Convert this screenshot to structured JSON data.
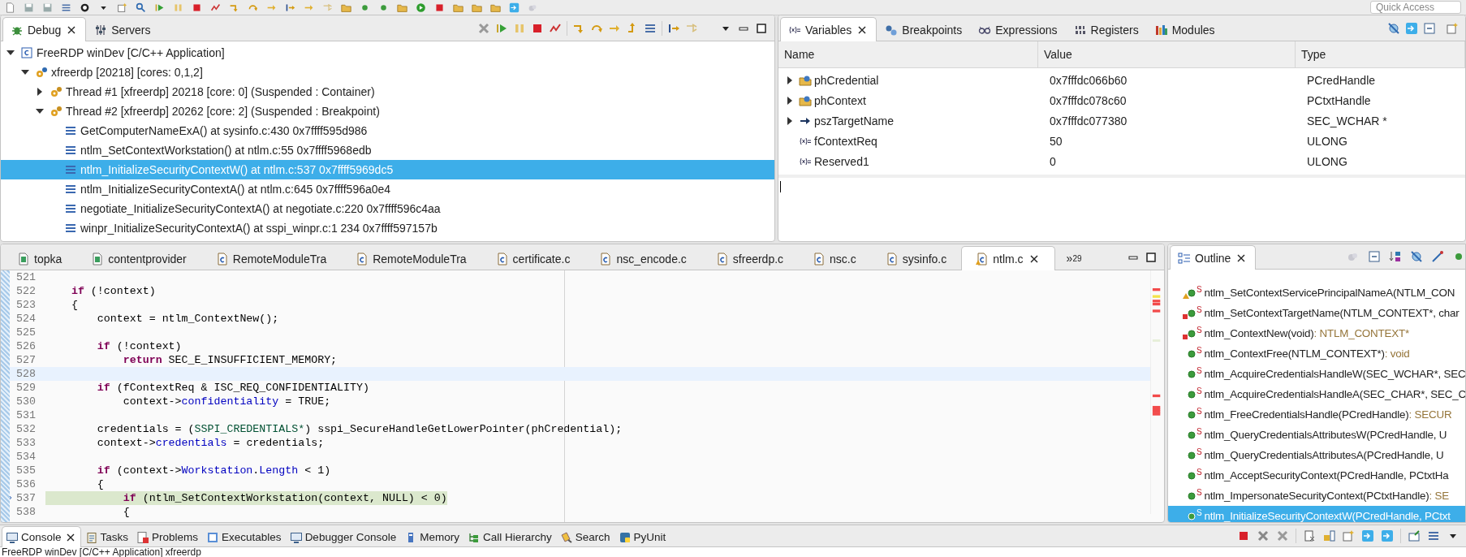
{
  "toolbar": {
    "quick_access": {
      "placeholder": "Quick Access"
    }
  },
  "debug_view": {
    "tabs": [
      {
        "label": "Debug",
        "selected": true,
        "closable": true
      },
      {
        "label": "Servers",
        "selected": false,
        "closable": false
      }
    ],
    "tree": [
      {
        "label": "FreeRDP winDev [C/C++ Application]",
        "kind": "launch",
        "expanded": true,
        "selected": false,
        "children": [
          {
            "label": "xfreerdp [20218] [cores: 0,1,2]",
            "kind": "process",
            "expanded": true,
            "selected": false,
            "children": [
              {
                "label": "Thread #1 [xfreerdp] 20218 [core: 0] (Suspended : Container)",
                "kind": "thread",
                "expanded": false,
                "selected": false
              },
              {
                "label": "Thread #2 [xfreerdp] 20262 [core: 2] (Suspended : Breakpoint)",
                "kind": "thread",
                "expanded": true,
                "selected": false,
                "children": [
                  {
                    "label": "GetComputerNameExA() at sysinfo.c:430 0x7ffff595d986",
                    "kind": "frame",
                    "selected": false
                  },
                  {
                    "label": "ntlm_SetContextWorkstation() at ntlm.c:55 0x7ffff5968edb",
                    "kind": "frame",
                    "selected": false
                  },
                  {
                    "label": "ntlm_InitializeSecurityContextW() at ntlm.c:537 0x7ffff5969dc5",
                    "kind": "frame",
                    "selected": true
                  },
                  {
                    "label": "ntlm_InitializeSecurityContextA() at ntlm.c:645 0x7ffff596a0e4",
                    "kind": "frame",
                    "selected": false
                  },
                  {
                    "label": "negotiate_InitializeSecurityContextA() at negotiate.c:220 0x7ffff596c4aa",
                    "kind": "frame",
                    "selected": false
                  },
                  {
                    "label": "winpr_InitializeSecurityContextA() at sspi_winpr.c:1 234 0x7ffff597157b",
                    "kind": "frame",
                    "selected": false
                  }
                ]
              }
            ]
          }
        ]
      }
    ]
  },
  "variables_view": {
    "tabs": [
      {
        "label": "Variables",
        "selected": true,
        "closable": true
      },
      {
        "label": "Breakpoints",
        "selected": false,
        "closable": false
      },
      {
        "label": "Expressions",
        "selected": false,
        "closable": false
      },
      {
        "label": "Registers",
        "selected": false,
        "closable": false
      },
      {
        "label": "Modules",
        "selected": false,
        "closable": false
      }
    ],
    "columns": [
      "Name",
      "Value",
      "Type"
    ],
    "rows": [
      {
        "name": "phCredential",
        "value": "0x7fffdc066b60",
        "type": "PCredHandle",
        "kind": "struct",
        "expandable": true
      },
      {
        "name": "phContext",
        "value": "0x7fffdc078c60",
        "type": "PCtxtHandle",
        "kind": "struct",
        "expandable": true
      },
      {
        "name": "pszTargetName",
        "value": "0x7fffdc077380",
        "type": "SEC_WCHAR *",
        "kind": "pointer",
        "expandable": true
      },
      {
        "name": "fContextReq",
        "value": "50",
        "type": "ULONG",
        "kind": "local",
        "expandable": false
      },
      {
        "name": "Reserved1",
        "value": "0",
        "type": "ULONG",
        "kind": "local",
        "expandable": false
      }
    ]
  },
  "editor": {
    "tabs": [
      {
        "label": "topka",
        "kind": "project",
        "selected": false,
        "warning": false,
        "closable": false
      },
      {
        "label": "contentprovider",
        "kind": "project",
        "selected": false,
        "warning": false,
        "closable": false
      },
      {
        "label": "RemoteModuleTra",
        "kind": "c",
        "selected": false,
        "warning": false,
        "closable": false
      },
      {
        "label": "RemoteModuleTra",
        "kind": "c",
        "selected": false,
        "warning": false,
        "closable": false
      },
      {
        "label": "certificate.c",
        "kind": "c",
        "selected": false,
        "warning": false,
        "closable": false
      },
      {
        "label": "nsc_encode.c",
        "kind": "c",
        "selected": false,
        "warning": false,
        "closable": false
      },
      {
        "label": "sfreerdp.c",
        "kind": "c",
        "selected": false,
        "warning": false,
        "closable": false
      },
      {
        "label": "nsc.c",
        "kind": "c",
        "selected": false,
        "warning": false,
        "closable": false
      },
      {
        "label": "sysinfo.c",
        "kind": "c",
        "selected": false,
        "warning": false,
        "closable": false
      },
      {
        "label": "ntlm.c",
        "kind": "c",
        "selected": true,
        "warning": true,
        "closable": true
      }
    ],
    "overflow": {
      "label": "»",
      "count": "29"
    },
    "lines": [
      {
        "number": "521"
      },
      {
        "number": "522",
        "tokens": [
          {
            "kind": "kw",
            "text": "    if"
          },
          {
            "kind": "plain",
            "text": " (!context)"
          }
        ]
      },
      {
        "number": "523",
        "tokens": [
          {
            "kind": "plain",
            "text": "    {"
          }
        ]
      },
      {
        "number": "524",
        "tokens": [
          {
            "kind": "plain",
            "text": "        context = ntlm_ContextNew();"
          }
        ]
      },
      {
        "number": "525"
      },
      {
        "number": "526",
        "tokens": [
          {
            "kind": "kw",
            "text": "        if"
          },
          {
            "kind": "plain",
            "text": " (!context)"
          }
        ]
      },
      {
        "number": "527",
        "tokens": [
          {
            "kind": "kw",
            "text": "            return"
          },
          {
            "kind": "plain",
            "text": " SEC_E_INSUFFICIENT_MEMORY;"
          }
        ]
      },
      {
        "number": "528",
        "cursor": true
      },
      {
        "number": "529",
        "tokens": [
          {
            "kind": "kw",
            "text": "        if"
          },
          {
            "kind": "plain",
            "text": " (fContextReq & ISC_REQ_CONFIDENTIALITY)"
          }
        ]
      },
      {
        "number": "530",
        "tokens": [
          {
            "kind": "plain",
            "text": "            context->"
          },
          {
            "kind": "field",
            "text": "confidentiality"
          },
          {
            "kind": "plain",
            "text": " = TRUE;"
          }
        ]
      },
      {
        "number": "531"
      },
      {
        "number": "532",
        "tokens": [
          {
            "kind": "plain",
            "text": "        credentials = ("
          },
          {
            "kind": "type",
            "text": "SSPI_CREDENTIALS*"
          },
          {
            "kind": "plain",
            "text": ") sspi_SecureHandleGetLowerPointer(phCredential);"
          }
        ]
      },
      {
        "number": "533",
        "tokens": [
          {
            "kind": "plain",
            "text": "        context->"
          },
          {
            "kind": "field",
            "text": "credentials"
          },
          {
            "kind": "plain",
            "text": " = credentials;"
          }
        ]
      },
      {
        "number": "534"
      },
      {
        "number": "535",
        "tokens": [
          {
            "kind": "kw",
            "text": "        if"
          },
          {
            "kind": "plain",
            "text": " (context->"
          },
          {
            "kind": "field",
            "text": "Workstation"
          },
          {
            "kind": "plain",
            "text": "."
          },
          {
            "kind": "field",
            "text": "Length"
          },
          {
            "kind": "plain",
            "text": " < 1)"
          }
        ]
      },
      {
        "number": "536",
        "tokens": [
          {
            "kind": "plain",
            "text": "        {"
          }
        ]
      },
      {
        "number": "537",
        "current": true,
        "tokens": [
          {
            "kind": "kw",
            "text": "            if"
          },
          {
            "kind": "plain",
            "text": " (ntlm_SetContextWorkstation(context, NULL) < 0)"
          }
        ]
      },
      {
        "number": "538",
        "tokens": [
          {
            "kind": "plain",
            "text": "            {"
          }
        ]
      }
    ]
  },
  "outline": {
    "tab": {
      "label": "Outline",
      "selected": true,
      "closable": true
    },
    "items": [
      {
        "signature": "ntlm_SetContextServicePrincipalNameA(NTLM_CON",
        "modifier": "S",
        "kind": "warning",
        "selected": false
      },
      {
        "signature": "ntlm_SetContextTargetName(NTLM_CONTEXT*, char",
        "modifier": "S",
        "kind": "error",
        "selected": false
      },
      {
        "signature": "ntlm_ContextNew(void)",
        "return_type": " : NTLM_CONTEXT*",
        "modifier": "S",
        "kind": "error",
        "selected": false
      },
      {
        "signature": "ntlm_ContextFree(NTLM_CONTEXT*)",
        "return_type": " : void",
        "modifier": "S",
        "kind": "method",
        "selected": false
      },
      {
        "signature": "ntlm_AcquireCredentialsHandleW(SEC_WCHAR*, SEC",
        "modifier": "S",
        "kind": "method",
        "selected": false
      },
      {
        "signature": "ntlm_AcquireCredentialsHandleA(SEC_CHAR*, SEC_C",
        "modifier": "S",
        "kind": "method",
        "selected": false
      },
      {
        "signature": "ntlm_FreeCredentialsHandle(PCredHandle)",
        "return_type": " : SECUR",
        "modifier": "S",
        "kind": "method",
        "selected": false
      },
      {
        "signature": "ntlm_QueryCredentialsAttributesW(PCredHandle, U",
        "modifier": "S",
        "kind": "method",
        "selected": false
      },
      {
        "signature": "ntlm_QueryCredentialsAttributesA(PCredHandle, U",
        "modifier": "S",
        "kind": "method",
        "selected": false
      },
      {
        "signature": "ntlm_AcceptSecurityContext(PCredHandle, PCtxtHa",
        "modifier": "S",
        "kind": "method",
        "selected": false
      },
      {
        "signature": "ntlm_ImpersonateSecurityContext(PCtxtHandle)",
        "return_type": " : SE",
        "modifier": "S",
        "kind": "method",
        "selected": false
      },
      {
        "signature": "ntlm_InitializeSecurityContextW(PCredHandle, PCtxt",
        "modifier": "S",
        "kind": "method",
        "selected": true
      }
    ]
  },
  "bottom": {
    "tabs": [
      {
        "label": "Console",
        "selected": true,
        "closable": true
      },
      {
        "label": "Tasks",
        "selected": false,
        "closable": false
      },
      {
        "label": "Problems",
        "selected": false,
        "closable": false
      },
      {
        "label": "Executables",
        "selected": false,
        "closable": false
      },
      {
        "label": "Debugger Console",
        "selected": false,
        "closable": false
      },
      {
        "label": "Memory",
        "selected": false,
        "closable": false
      },
      {
        "label": "Call Hierarchy",
        "selected": false,
        "closable": false
      },
      {
        "label": "Search",
        "selected": false,
        "closable": false
      },
      {
        "label": "PyUnit",
        "selected": false,
        "closable": false
      }
    ],
    "console_title": "FreeRDP winDev [C/C++ Application] xfreerdp"
  }
}
